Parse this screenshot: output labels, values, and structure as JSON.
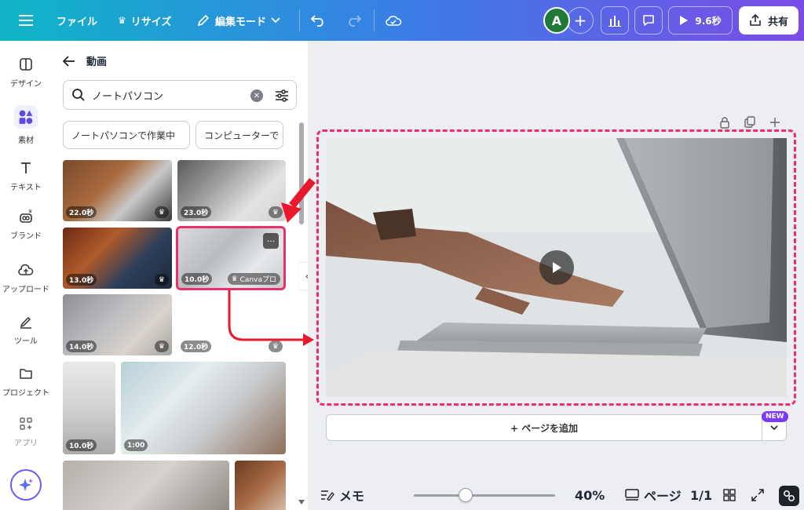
{
  "topbar": {
    "menu_icon": "hamburger-icon",
    "file_label": "ファイル",
    "resize_label": "リサイズ",
    "edit_mode_label": "編集モード",
    "avatar_initial": "A",
    "play_duration": "9.6秒",
    "share_label": "共有"
  },
  "rail": {
    "items": [
      {
        "label": "デザイン",
        "icon": "layout-icon"
      },
      {
        "label": "素材",
        "icon": "elements-icon"
      },
      {
        "label": "テキスト",
        "icon": "text-icon"
      },
      {
        "label": "ブランド",
        "icon": "brand-icon"
      },
      {
        "label": "アップロード",
        "icon": "upload-cloud-icon"
      },
      {
        "label": "ツール",
        "icon": "draw-icon"
      },
      {
        "label": "プロジェクト",
        "icon": "folder-icon"
      },
      {
        "label": "アプリ",
        "icon": "apps-icon"
      }
    ]
  },
  "panel": {
    "title": "動画",
    "search_value": "ノートパソコン",
    "chips": [
      "ノートパソコンで作業中",
      "コンピューターで"
    ],
    "videos": [
      {
        "duration": "22.0秒",
        "premium": true
      },
      {
        "duration": "23.0秒",
        "premium": true
      },
      {
        "duration": "13.0秒",
        "premium": true
      },
      {
        "duration": "10.0秒",
        "premium": true,
        "badge": "Canvaプロ",
        "selected": true
      },
      {
        "duration": "14.0秒",
        "premium": true
      },
      {
        "duration": "12.0秒",
        "premium": true
      },
      {
        "duration": "10.0秒",
        "premium": false
      },
      {
        "duration": "1:00",
        "premium": false
      }
    ],
    "more_label": "···"
  },
  "canvas": {
    "add_page_label": "+ ページを追加",
    "new_badge": "NEW",
    "highlight_color": "#e8316c",
    "arrow_color": "#e8192c"
  },
  "footer": {
    "notes_label": "メモ",
    "zoom_value": "40%",
    "zoom_fraction": 0.37,
    "pages_label": "ページ",
    "page_count": "1/1"
  }
}
